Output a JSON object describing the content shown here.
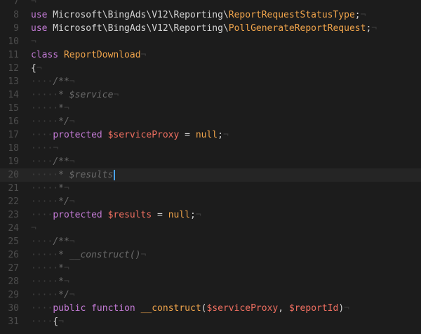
{
  "editor": {
    "lines": [
      {
        "no": "7",
        "tokens": [
          {
            "t": "¬",
            "c": "ws"
          }
        ]
      },
      {
        "no": "8",
        "tokens": [
          {
            "t": "use",
            "c": "kw"
          },
          {
            "t": " Microsoft\\BingAds\\V12\\Reporting\\",
            "c": "ns"
          },
          {
            "t": "ReportRequestStatusType",
            "c": "cls"
          },
          {
            "t": ";",
            "c": "plain"
          },
          {
            "t": "¬",
            "c": "ws"
          }
        ]
      },
      {
        "no": "9",
        "tokens": [
          {
            "t": "use",
            "c": "kw"
          },
          {
            "t": " Microsoft\\BingAds\\V12\\Reporting\\",
            "c": "ns"
          },
          {
            "t": "PollGenerateReportRequest",
            "c": "cls"
          },
          {
            "t": ";",
            "c": "plain"
          },
          {
            "t": "¬",
            "c": "ws"
          }
        ]
      },
      {
        "no": "10",
        "tokens": [
          {
            "t": "¬",
            "c": "ws"
          }
        ]
      },
      {
        "no": "11",
        "tokens": [
          {
            "t": "class",
            "c": "kw"
          },
          {
            "t": " ",
            "c": "plain"
          },
          {
            "t": "ReportDownload",
            "c": "cls"
          },
          {
            "t": "¬",
            "c": "ws"
          }
        ]
      },
      {
        "no": "12",
        "tokens": [
          {
            "t": "{",
            "c": "plain"
          },
          {
            "t": "¬",
            "c": "ws"
          }
        ]
      },
      {
        "no": "13",
        "tokens": [
          {
            "t": "····",
            "c": "ws"
          },
          {
            "t": "/**",
            "c": "cmt"
          },
          {
            "t": "¬",
            "c": "ws"
          }
        ]
      },
      {
        "no": "14",
        "tokens": [
          {
            "t": "·····",
            "c": "ws"
          },
          {
            "t": "* $service",
            "c": "cmt"
          },
          {
            "t": "¬",
            "c": "ws"
          }
        ]
      },
      {
        "no": "15",
        "tokens": [
          {
            "t": "·····",
            "c": "ws"
          },
          {
            "t": "*",
            "c": "cmt"
          },
          {
            "t": "¬",
            "c": "ws"
          }
        ]
      },
      {
        "no": "16",
        "tokens": [
          {
            "t": "·····",
            "c": "ws"
          },
          {
            "t": "*/",
            "c": "cmt"
          },
          {
            "t": "¬",
            "c": "ws"
          }
        ]
      },
      {
        "no": "17",
        "tokens": [
          {
            "t": "····",
            "c": "ws"
          },
          {
            "t": "protected",
            "c": "kw"
          },
          {
            "t": " ",
            "c": "plain"
          },
          {
            "t": "$serviceProxy",
            "c": "var"
          },
          {
            "t": " = ",
            "c": "plain"
          },
          {
            "t": "null",
            "c": "cls"
          },
          {
            "t": ";",
            "c": "plain"
          },
          {
            "t": "¬",
            "c": "ws"
          }
        ]
      },
      {
        "no": "18",
        "tokens": [
          {
            "t": "····",
            "c": "ws"
          },
          {
            "t": "¬",
            "c": "ws"
          }
        ]
      },
      {
        "no": "19",
        "tokens": [
          {
            "t": "····",
            "c": "ws"
          },
          {
            "t": "/**",
            "c": "cmt"
          },
          {
            "t": "¬",
            "c": "ws"
          }
        ]
      },
      {
        "no": "20",
        "current": true,
        "cursor": true,
        "tokens": [
          {
            "t": "·····",
            "c": "ws"
          },
          {
            "t": "* $results",
            "c": "cmt"
          }
        ]
      },
      {
        "no": "21",
        "tokens": [
          {
            "t": "·····",
            "c": "ws"
          },
          {
            "t": "*",
            "c": "cmt"
          },
          {
            "t": "¬",
            "c": "ws"
          }
        ]
      },
      {
        "no": "22",
        "tokens": [
          {
            "t": "·····",
            "c": "ws"
          },
          {
            "t": "*/",
            "c": "cmt"
          },
          {
            "t": "¬",
            "c": "ws"
          }
        ]
      },
      {
        "no": "23",
        "tokens": [
          {
            "t": "····",
            "c": "ws"
          },
          {
            "t": "protected",
            "c": "kw"
          },
          {
            "t": " ",
            "c": "plain"
          },
          {
            "t": "$results",
            "c": "var"
          },
          {
            "t": " = ",
            "c": "plain"
          },
          {
            "t": "null",
            "c": "cls"
          },
          {
            "t": ";",
            "c": "plain"
          },
          {
            "t": "¬",
            "c": "ws"
          }
        ]
      },
      {
        "no": "24",
        "tokens": [
          {
            "t": "¬",
            "c": "ws"
          }
        ]
      },
      {
        "no": "25",
        "tokens": [
          {
            "t": "····",
            "c": "ws"
          },
          {
            "t": "/**",
            "c": "cmt"
          },
          {
            "t": "¬",
            "c": "ws"
          }
        ]
      },
      {
        "no": "26",
        "tokens": [
          {
            "t": "·····",
            "c": "ws"
          },
          {
            "t": "* __construct()",
            "c": "cmt"
          },
          {
            "t": "¬",
            "c": "ws"
          }
        ]
      },
      {
        "no": "27",
        "tokens": [
          {
            "t": "·····",
            "c": "ws"
          },
          {
            "t": "*",
            "c": "cmt"
          },
          {
            "t": "¬",
            "c": "ws"
          }
        ]
      },
      {
        "no": "28",
        "tokens": [
          {
            "t": "·····",
            "c": "ws"
          },
          {
            "t": "*",
            "c": "cmt"
          },
          {
            "t": "¬",
            "c": "ws"
          }
        ]
      },
      {
        "no": "29",
        "tokens": [
          {
            "t": "·····",
            "c": "ws"
          },
          {
            "t": "*/",
            "c": "cmt"
          },
          {
            "t": "¬",
            "c": "ws"
          }
        ]
      },
      {
        "no": "30",
        "tokens": [
          {
            "t": "····",
            "c": "ws"
          },
          {
            "t": "public",
            "c": "kw"
          },
          {
            "t": " ",
            "c": "plain"
          },
          {
            "t": "function",
            "c": "kw"
          },
          {
            "t": " ",
            "c": "plain"
          },
          {
            "t": "__construct",
            "c": "cls"
          },
          {
            "t": "(",
            "c": "plain"
          },
          {
            "t": "$serviceProxy",
            "c": "var"
          },
          {
            "t": ", ",
            "c": "plain"
          },
          {
            "t": "$reportId",
            "c": "var"
          },
          {
            "t": ")",
            "c": "plain"
          },
          {
            "t": "¬",
            "c": "ws"
          }
        ]
      },
      {
        "no": "31",
        "tokens": [
          {
            "t": "····",
            "c": "ws"
          },
          {
            "t": "{",
            "c": "plain"
          },
          {
            "t": "¬",
            "c": "ws"
          }
        ]
      }
    ]
  }
}
